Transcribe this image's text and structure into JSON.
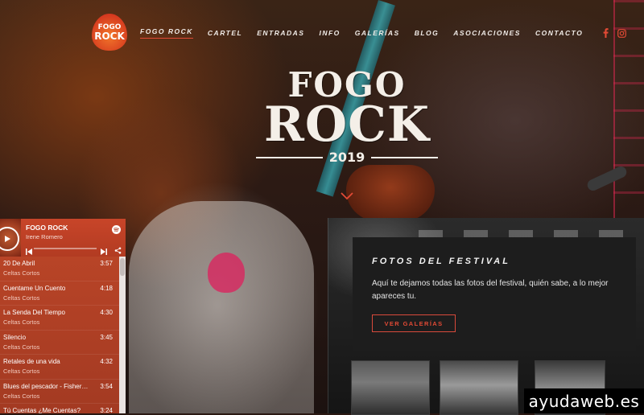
{
  "logo": {
    "line1": "FOGO",
    "line2": "ROCK"
  },
  "nav": {
    "items": [
      {
        "label": "FOGO ROCK",
        "active": true
      },
      {
        "label": "CARTEL"
      },
      {
        "label": "ENTRADAS"
      },
      {
        "label": "INFO"
      },
      {
        "label": "GALERÍAS"
      },
      {
        "label": "BLOG"
      },
      {
        "label": "ASOCIACIONES"
      },
      {
        "label": "CONTACTO"
      }
    ],
    "social_icons": [
      "facebook-icon",
      "instagram-icon"
    ]
  },
  "hero": {
    "line1": "FOGO",
    "line2": "ROCK",
    "year": "2019"
  },
  "player": {
    "title": "FOGO ROCK",
    "artist": "Irene Romero",
    "progress": 0.0,
    "tracks": [
      {
        "name": "20 De Abril",
        "artist": "Celtas Cortos",
        "time": "3:57"
      },
      {
        "name": "Cuentame Un Cuento",
        "artist": "Celtas Cortos",
        "time": "4:18"
      },
      {
        "name": "La Senda Del Tiempo",
        "artist": "Celtas Cortos",
        "time": "4:30"
      },
      {
        "name": "Silencio",
        "artist": "Celtas Cortos",
        "time": "3:45"
      },
      {
        "name": "Retales de una vida",
        "artist": "Celtas Cortos",
        "time": "4:32"
      },
      {
        "name": "Blues del pescador - Fisherm...",
        "artist": "Celtas Cortos",
        "time": "3:54"
      },
      {
        "name": "Tú Cuentas ¿Me Cuentas?",
        "artist": "",
        "time": "3:24"
      }
    ]
  },
  "photos": {
    "title": "FOTOS DEL FESTIVAL",
    "text": "Aquí te dejamos todas las fotos del festival, quién sabe, a lo mejor apareces tu.",
    "button": "VER GALERÍAS"
  },
  "watermark": "ayudaweb.es",
  "colors": {
    "accent": "#e24a35",
    "player": "#b23b22",
    "card": "#1d1d1d"
  }
}
